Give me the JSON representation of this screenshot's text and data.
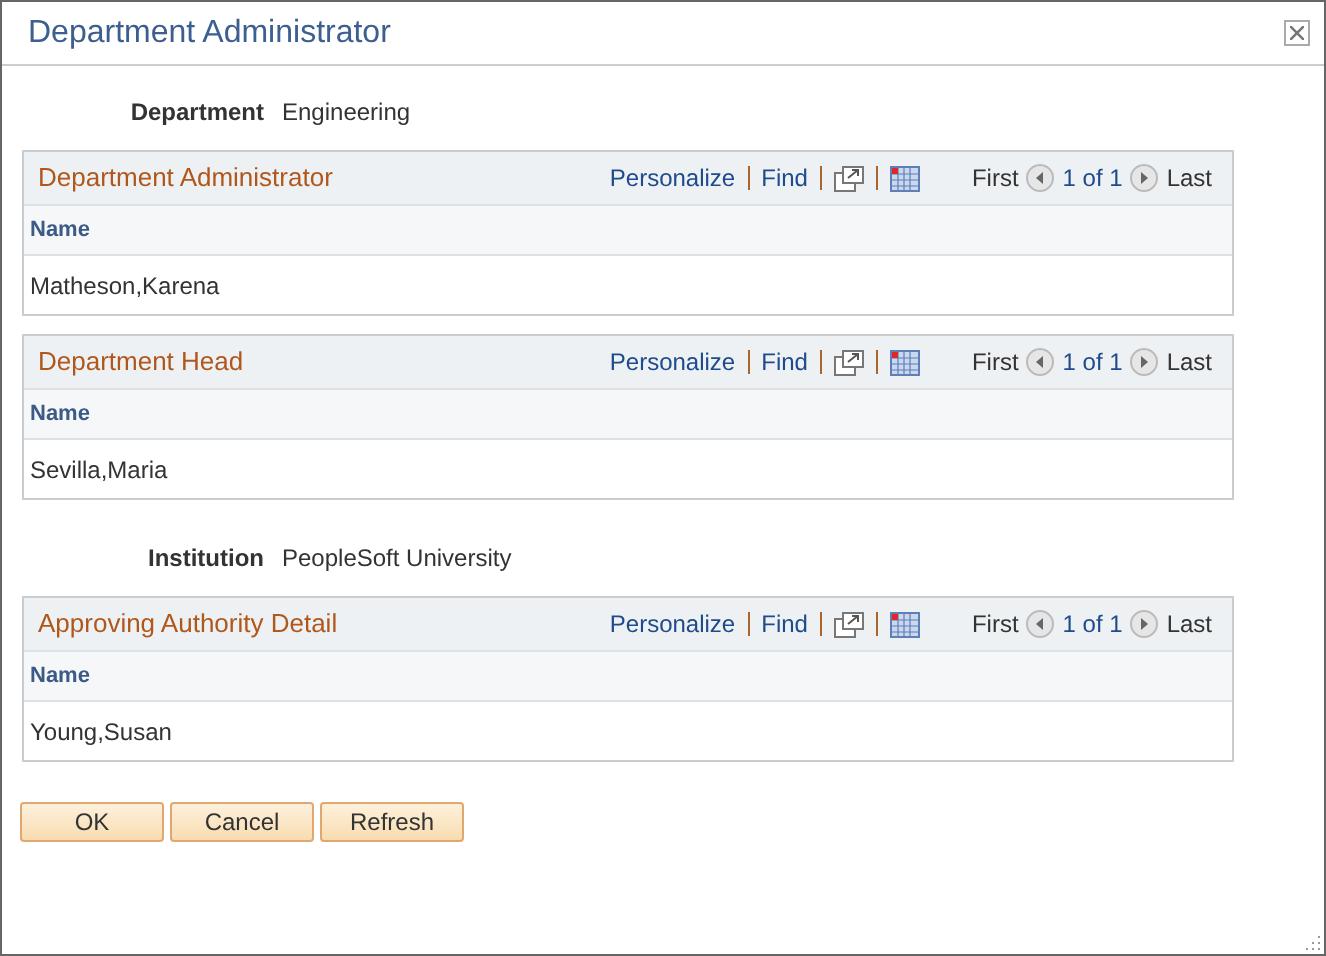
{
  "window": {
    "title": "Department Administrator"
  },
  "sections": [
    {
      "kind": "field",
      "label": "Department",
      "value": "Engineering"
    },
    {
      "kind": "grid",
      "title": "Department Administrator",
      "links": [
        "Personalize",
        "Find"
      ],
      "first": "First",
      "count": "1 of 1",
      "last": "Last",
      "column": "Name",
      "rows": [
        "Matheson,Karena"
      ]
    },
    {
      "kind": "grid",
      "title": "Department Head",
      "links": [
        "Personalize",
        "Find"
      ],
      "first": "First",
      "count": "1 of 1",
      "last": "Last",
      "column": "Name",
      "rows": [
        "Sevilla,Maria"
      ]
    },
    {
      "kind": "field",
      "label": "Institution",
      "value": "PeopleSoft University"
    },
    {
      "kind": "grid",
      "title": "Approving Authority Detail",
      "links": [
        "Personalize",
        "Find"
      ],
      "first": "First",
      "count": "1 of 1",
      "last": "Last",
      "column": "Name",
      "rows": [
        "Young,Susan"
      ]
    }
  ],
  "buttons": [
    "OK",
    "Cancel",
    "Refresh"
  ]
}
